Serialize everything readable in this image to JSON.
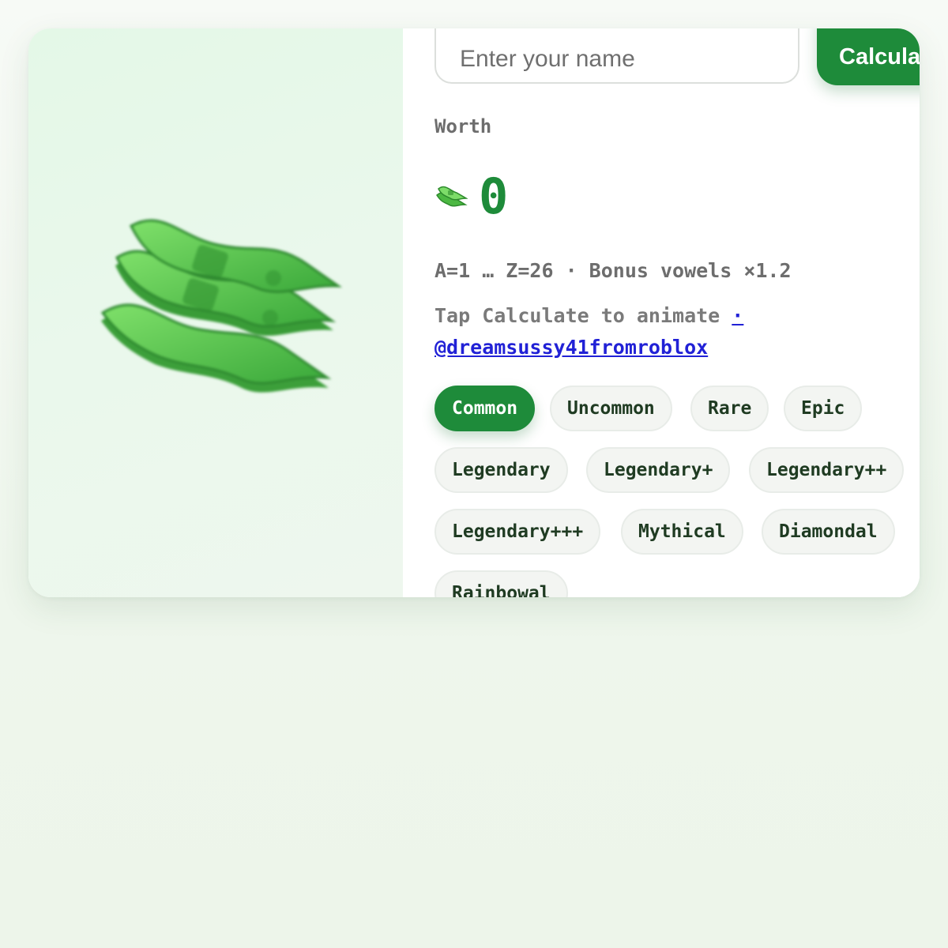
{
  "form": {
    "name_placeholder": "Enter your name",
    "name_value": "",
    "calculate_label": "Calcula"
  },
  "result": {
    "worth_label": "Worth",
    "cash_icon": "money-with-wings-icon",
    "worth_value": "0"
  },
  "info": {
    "formula": "A=1 … Z=26 · Bonus vowels ×1.2",
    "hint": "Tap Calculate to animate ",
    "link_text": "· @dreamsussy41fromroblox"
  },
  "rarities": [
    {
      "label": "Common",
      "selected": true
    },
    {
      "label": "Uncommon",
      "selected": false
    },
    {
      "label": "Rare",
      "selected": false
    },
    {
      "label": "Epic",
      "selected": false
    },
    {
      "label": "Legendary",
      "selected": false
    },
    {
      "label": "Legendary+",
      "selected": false
    },
    {
      "label": "Legendary++",
      "selected": false
    },
    {
      "label": "Legendary+++",
      "selected": false
    },
    {
      "label": "Mythical",
      "selected": false
    },
    {
      "label": "Diamondal",
      "selected": false
    },
    {
      "label": "Rainbowal",
      "selected": false
    }
  ],
  "colors": {
    "accent": "#1e8b3a",
    "link": "#2121d6",
    "chip_bg": "#f3f5f2",
    "panel_bg": "#e8f8ea"
  }
}
